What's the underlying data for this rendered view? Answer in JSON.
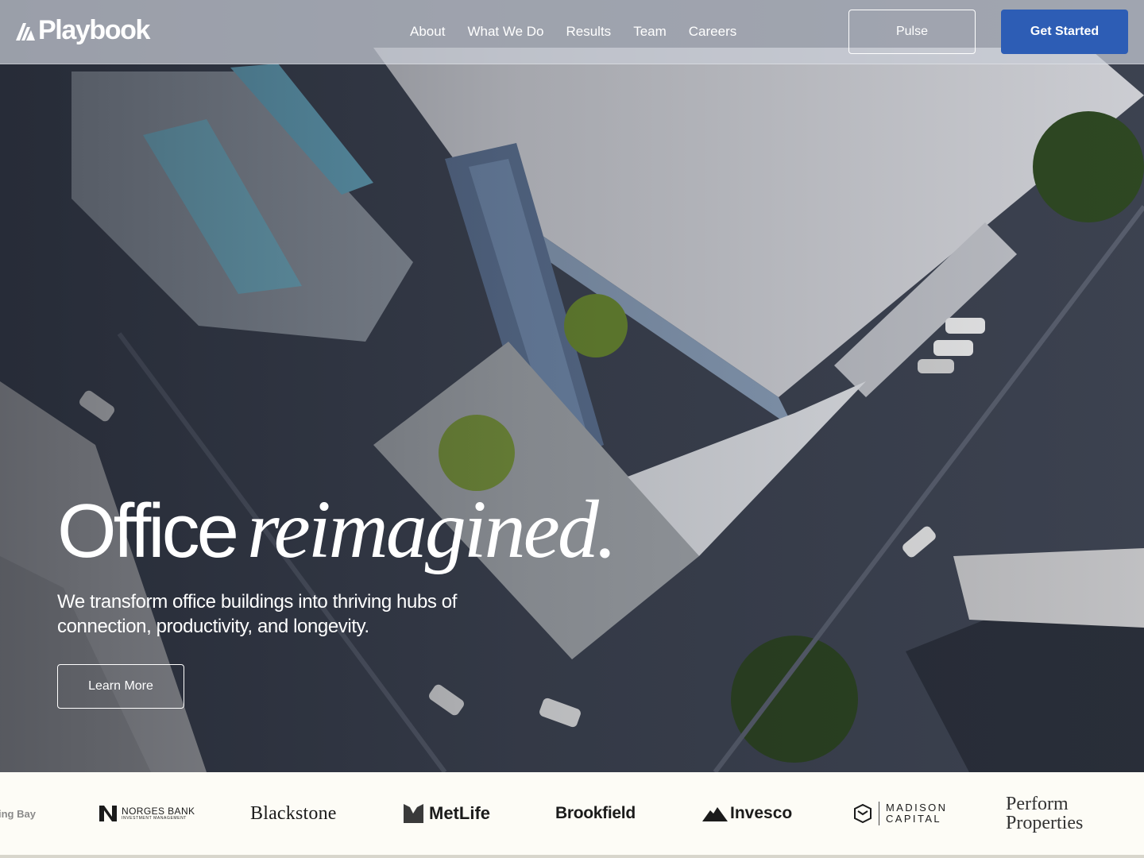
{
  "brand": {
    "logo_text": "Playbook",
    "accent": "#2d5db5"
  },
  "nav": {
    "links": [
      "About",
      "What We Do",
      "Results",
      "Team",
      "Careers"
    ],
    "pulse_label": "Pulse",
    "cta_label": "Get Started"
  },
  "hero": {
    "headline_plain": "Office",
    "headline_italic": "reimagined.",
    "subtitle": "We transform office buildings into thriving hubs of connection, productivity, and longevity.",
    "learn_more_label": "Learn More",
    "background": "aerial-city-photo"
  },
  "partners": {
    "partial": "ing Bay",
    "norges_top": "NORGES BANK",
    "norges_sub": "INVESTMENT MANAGEMENT",
    "blackstone": "Blackstone",
    "metlife": "MetLife",
    "brookfield": "Brookfield",
    "invesco": "Invesco",
    "madison_line1": "MADISON",
    "madison_line2": "CAPITAL",
    "perform_line1": "Perform",
    "perform_line2": "Properties"
  }
}
